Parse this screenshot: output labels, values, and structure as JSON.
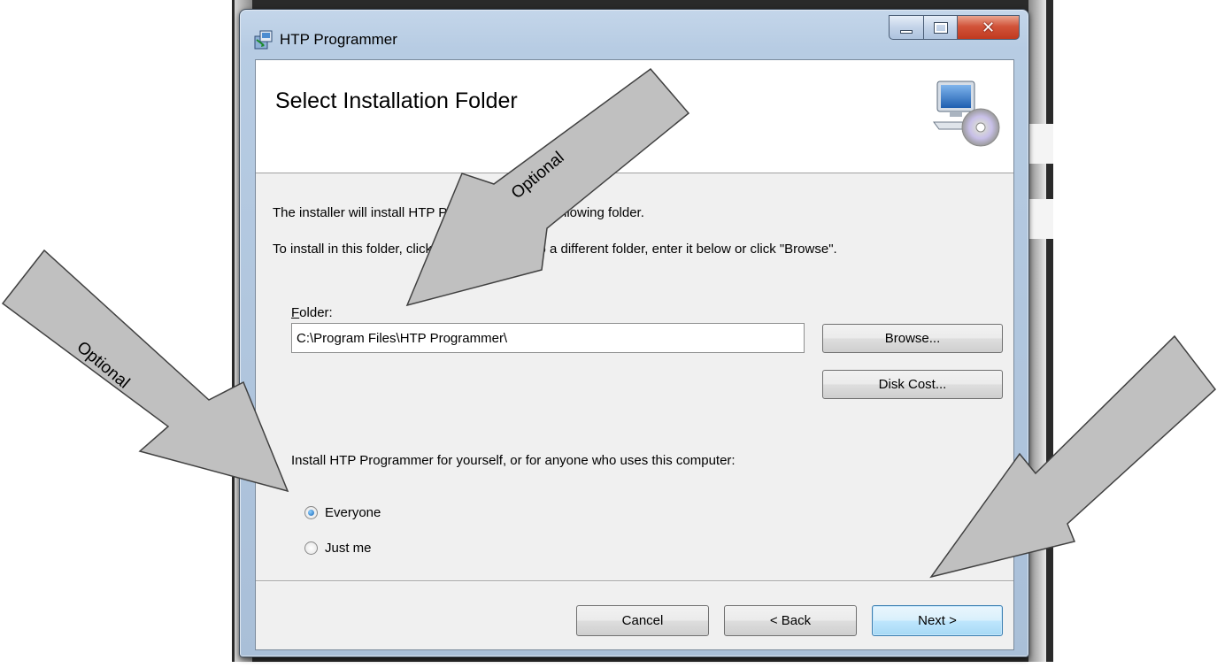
{
  "window": {
    "title": "HTP Programmer",
    "icon": "installer-icon"
  },
  "banner": {
    "title": "Select Installation Folder",
    "icon": "computer-cd-icon"
  },
  "body": {
    "line1": "The installer will install HTP Programmer to the following folder.",
    "line2": "To install in this folder, click \"Next\". To install to a different folder, enter it below or click \"Browse\".",
    "folder_label": "Folder:",
    "folder_value": "C:\\Program Files\\HTP Programmer\\",
    "browse_label": "Browse...",
    "diskcost_label": "Disk Cost...",
    "install_for": "Install HTP Programmer for yourself, or for anyone who uses this computer:",
    "options": [
      {
        "label": "Everyone",
        "selected": true
      },
      {
        "label": "Just me",
        "selected": false
      }
    ]
  },
  "footer": {
    "cancel_label": "Cancel",
    "back_label": "< Back",
    "next_label": "Next >"
  },
  "annotations": {
    "arrow_top_label": "Optional",
    "arrow_left_label": "Optional",
    "arrow_fill": "#c0c0c0"
  }
}
